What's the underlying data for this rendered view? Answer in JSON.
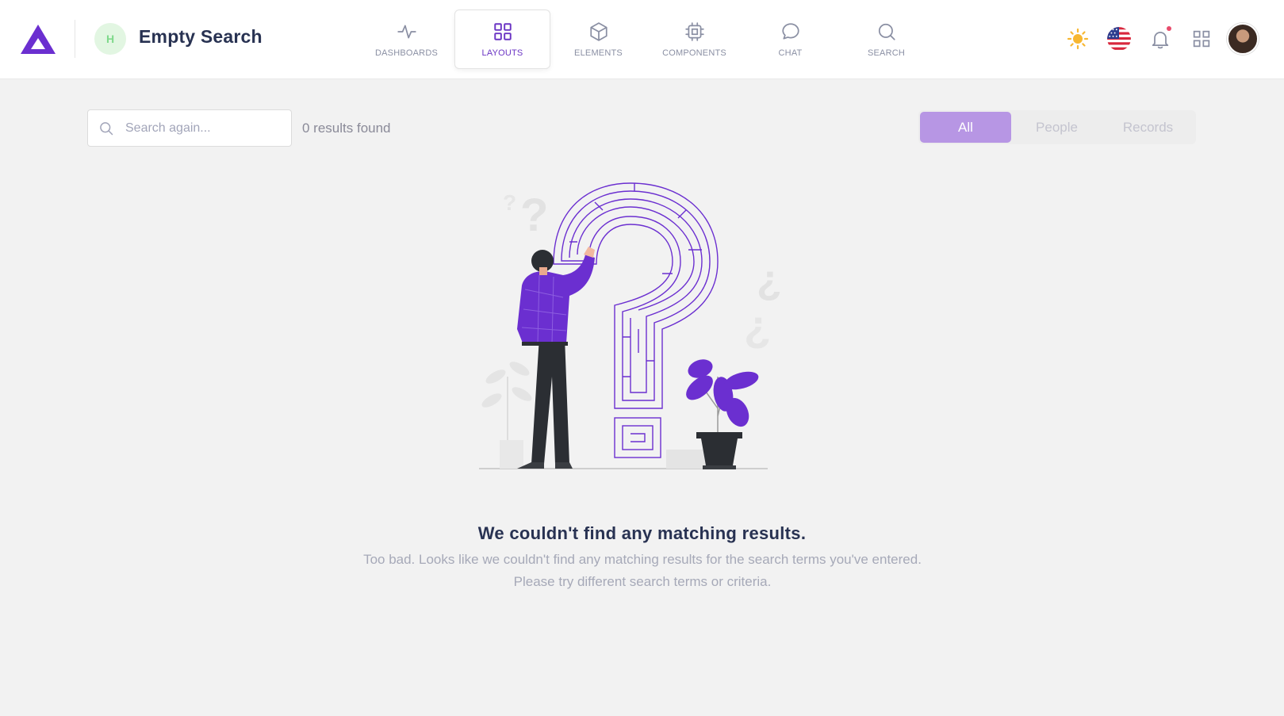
{
  "header": {
    "logo_icon": "triangle-logo-icon",
    "project_initial": "H",
    "page_title": "Empty Search",
    "nav_tabs": [
      {
        "label": "DASHBOARDS",
        "icon": "activity-icon",
        "active": false
      },
      {
        "label": "LAYOUTS",
        "icon": "grid-icon",
        "active": true
      },
      {
        "label": "ELEMENTS",
        "icon": "box-icon",
        "active": false
      },
      {
        "label": "COMPONENTS",
        "icon": "cpu-icon",
        "active": false
      },
      {
        "label": "CHAT",
        "icon": "chat-bubble-icon",
        "active": false
      },
      {
        "label": "SEARCH",
        "icon": "search-icon",
        "active": false
      }
    ],
    "right_icons": [
      "sun-icon",
      "us-flag-icon",
      "bell-icon",
      "apps-grid-icon",
      "user-avatar"
    ]
  },
  "search": {
    "placeholder": "Search again...",
    "value": "",
    "results_text": "0 results found"
  },
  "filters": {
    "tabs": [
      {
        "label": "All",
        "active": true
      },
      {
        "label": "People",
        "active": false
      },
      {
        "label": "Records",
        "active": false
      }
    ]
  },
  "empty_state": {
    "illustration": "maze-question-mark-illustration",
    "title": "We couldn't find any matching results.",
    "body": "Too bad. Looks like we couldn't find any matching results for the search terms you've entered. Please try different search terms or criteria."
  },
  "colors": {
    "accent": "#6b35c4",
    "active_filter": "#b796e4",
    "bell_dot": "#e84b6c",
    "project_avatar_bg": "#e2f6e2"
  }
}
